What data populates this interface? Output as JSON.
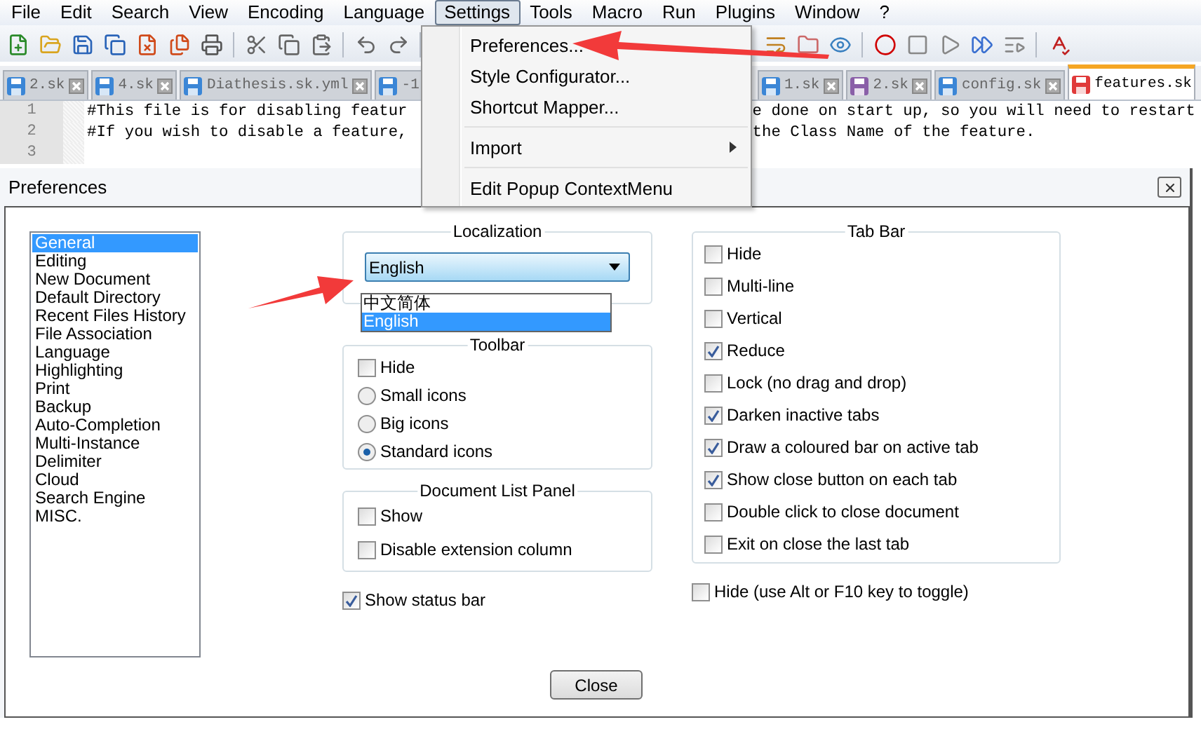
{
  "menu_bar": [
    {
      "label": "File",
      "selected": false
    },
    {
      "label": "Edit",
      "selected": false
    },
    {
      "label": "Search",
      "selected": false
    },
    {
      "label": "View",
      "selected": false
    },
    {
      "label": "Encoding",
      "selected": false
    },
    {
      "label": "Language",
      "selected": false
    },
    {
      "label": "Settings",
      "selected": true
    },
    {
      "label": "Tools",
      "selected": false
    },
    {
      "label": "Macro",
      "selected": false
    },
    {
      "label": "Run",
      "selected": false
    },
    {
      "label": "Plugins",
      "selected": false
    },
    {
      "label": "Window",
      "selected": false
    },
    {
      "label": "?",
      "selected": false
    }
  ],
  "settings_menu": [
    {
      "kind": "item",
      "label": "Preferences..."
    },
    {
      "kind": "item",
      "label": "Style Configurator..."
    },
    {
      "kind": "item",
      "label": "Shortcut Mapper..."
    },
    {
      "kind": "separator"
    },
    {
      "kind": "submenu",
      "label": "Import"
    },
    {
      "kind": "separator"
    },
    {
      "kind": "item",
      "label": "Edit Popup ContextMenu"
    }
  ],
  "tabs_left": [
    {
      "label": "2.sk",
      "selected": false,
      "close_button": true,
      "color": "#3b86d6"
    },
    {
      "label": "4.sk",
      "selected": false,
      "close_button": true,
      "color": "#3b86d6"
    },
    {
      "label": "Diathesis.sk.yml",
      "selected": false,
      "close_button": true,
      "color": "#3b86d6"
    },
    {
      "label": "-1",
      "selected": false,
      "close_button": false,
      "color": "#3b86d6"
    }
  ],
  "tabs_right": [
    {
      "label": "1.sk",
      "selected": false,
      "close_button": true,
      "color": "#3b86d6"
    },
    {
      "label": "2.sk",
      "selected": false,
      "close_button": true,
      "color": "#8a5fa8"
    },
    {
      "label": "config.sk",
      "selected": false,
      "close_button": true,
      "color": "#3b86d6"
    },
    {
      "label": "features.sk",
      "selected": true,
      "close_button": false,
      "color": "#e03a3a"
    }
  ],
  "editor": {
    "lines": [
      {
        "number": "1",
        "segments": [
          "#This file is for disabling featur",
          "e done on start up, so you will need to restart"
        ]
      },
      {
        "number": "2",
        "segments": [
          "#If you wish to disable a feature,",
          "the Class Name of the feature."
        ]
      },
      {
        "number": "3"
      }
    ]
  },
  "preferences": {
    "title": "Preferences",
    "categories": [
      {
        "label": "General",
        "selected": true
      },
      {
        "label": "Editing",
        "selected": false
      },
      {
        "label": "New Document",
        "selected": false
      },
      {
        "label": "Default Directory",
        "selected": false
      },
      {
        "label": "Recent Files History",
        "selected": false
      },
      {
        "label": "File Association",
        "selected": false
      },
      {
        "label": "Language",
        "selected": false
      },
      {
        "label": "Highlighting",
        "selected": false
      },
      {
        "label": "Print",
        "selected": false
      },
      {
        "label": "Backup",
        "selected": false
      },
      {
        "label": "Auto-Completion",
        "selected": false
      },
      {
        "label": "Multi-Instance",
        "selected": false
      },
      {
        "label": "Delimiter",
        "selected": false
      },
      {
        "label": "Cloud",
        "selected": false
      },
      {
        "label": "Search Engine",
        "selected": false
      },
      {
        "label": "MISC.",
        "selected": false
      }
    ],
    "localization": {
      "title": "Localization",
      "value": "English",
      "options": [
        {
          "label": "中文简体",
          "selected": false
        },
        {
          "label": "English",
          "selected": true
        }
      ]
    },
    "toolbar": {
      "title": "Toolbar",
      "hide": {
        "label": "Hide",
        "checked": false
      },
      "icon_sizes": [
        {
          "label": "Small icons",
          "selected": false
        },
        {
          "label": "Big icons",
          "selected": false
        },
        {
          "label": "Standard icons",
          "selected": true
        }
      ]
    },
    "document_list_panel": {
      "title": "Document List Panel",
      "options": [
        {
          "label": "Show",
          "checked": false
        },
        {
          "label": "Disable extension column",
          "checked": false
        }
      ]
    },
    "status_bar": {
      "label": "Show status bar",
      "checked": true
    },
    "tab_bar": {
      "title": "Tab Bar",
      "options": [
        {
          "label": "Hide",
          "checked": false
        },
        {
          "label": "Multi-line",
          "checked": false
        },
        {
          "label": "Vertical",
          "checked": false
        },
        {
          "label": "Reduce",
          "checked": true
        },
        {
          "label": "Lock (no drag and drop)",
          "checked": false
        },
        {
          "label": "Darken inactive tabs",
          "checked": true
        },
        {
          "label": "Draw a coloured bar on active tab",
          "checked": true
        },
        {
          "label": "Show close button on each tab",
          "checked": true
        },
        {
          "label": "Double click to close document",
          "checked": false
        },
        {
          "label": "Exit on close the last tab",
          "checked": false
        }
      ]
    },
    "menu_bar_hide": {
      "label": "Hide (use Alt or F10 key to toggle)",
      "checked": false
    },
    "close_button": "Close"
  }
}
